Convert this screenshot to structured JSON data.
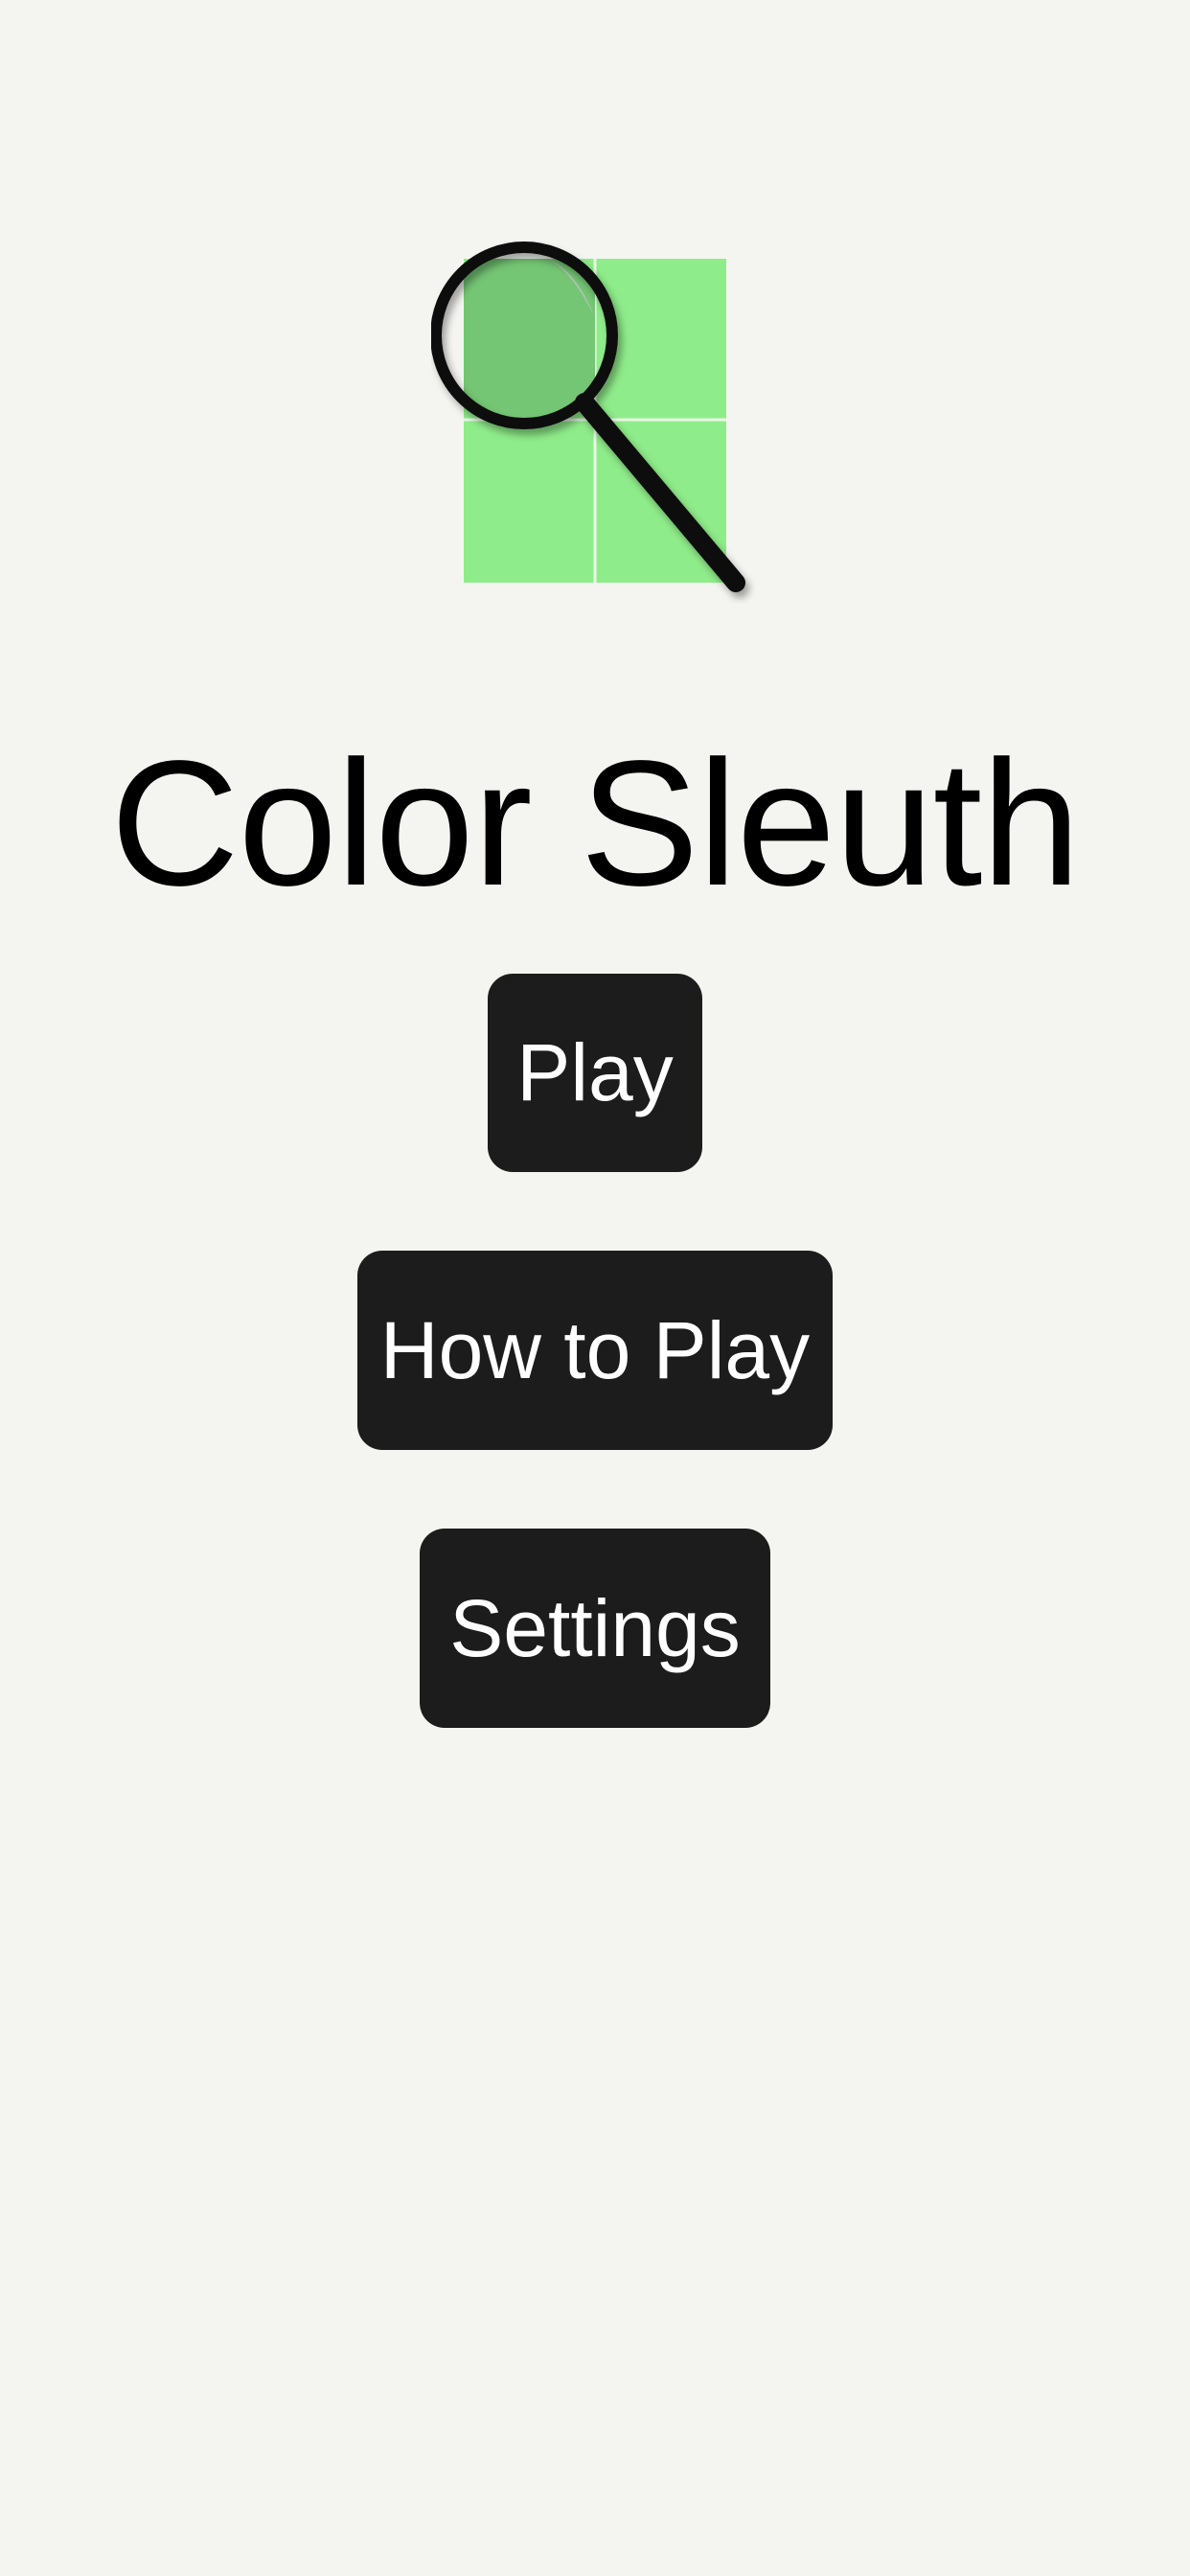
{
  "app": {
    "title": "Color Sleuth",
    "logo_icon": "magnifier-over-green-grid-icon",
    "colors": {
      "background": "#f4f5f1",
      "grid_green": "#8fec8a",
      "grid_green_highlight": "#74c574",
      "button_background": "#1c1c1c",
      "button_text": "#ffffff",
      "title_text": "#000000"
    }
  },
  "menu": {
    "play_label": "Play",
    "how_to_play_label": "How to Play",
    "settings_label": "Settings"
  }
}
